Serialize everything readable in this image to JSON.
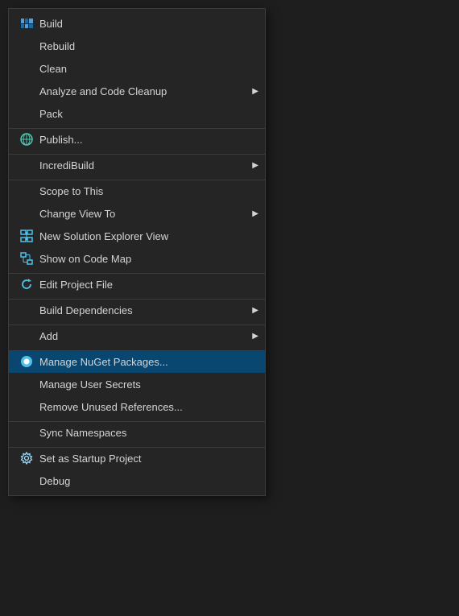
{
  "menu": {
    "items": [
      {
        "id": "build",
        "label": "Build",
        "hasIcon": true,
        "iconType": "build",
        "hasArrow": false,
        "hasDivider": false,
        "highlighted": false
      },
      {
        "id": "rebuild",
        "label": "Rebuild",
        "hasIcon": false,
        "iconType": "",
        "hasArrow": false,
        "hasDivider": false,
        "highlighted": false
      },
      {
        "id": "clean",
        "label": "Clean",
        "hasIcon": false,
        "iconType": "",
        "hasArrow": false,
        "hasDivider": false,
        "highlighted": false
      },
      {
        "id": "analyze-code-cleanup",
        "label": "Analyze and Code Cleanup",
        "hasIcon": false,
        "iconType": "",
        "hasArrow": true,
        "hasDivider": false,
        "highlighted": false
      },
      {
        "id": "pack",
        "label": "Pack",
        "hasIcon": false,
        "iconType": "",
        "hasArrow": false,
        "hasDivider": false,
        "highlighted": false
      },
      {
        "id": "publish",
        "label": "Publish...",
        "hasIcon": true,
        "iconType": "globe",
        "hasArrow": false,
        "hasDivider": true,
        "highlighted": false
      },
      {
        "id": "incredibuild",
        "label": "IncrediBuild",
        "hasIcon": false,
        "iconType": "",
        "hasArrow": true,
        "hasDivider": true,
        "highlighted": false
      },
      {
        "id": "scope-to-this",
        "label": "Scope to This",
        "hasIcon": false,
        "iconType": "",
        "hasArrow": false,
        "hasDivider": true,
        "highlighted": false
      },
      {
        "id": "change-view-to",
        "label": "Change View To",
        "hasIcon": false,
        "iconType": "",
        "hasArrow": true,
        "hasDivider": false,
        "highlighted": false
      },
      {
        "id": "new-solution-explorer",
        "label": "New Solution Explorer View",
        "hasIcon": true,
        "iconType": "solution",
        "hasArrow": false,
        "hasDivider": false,
        "highlighted": false
      },
      {
        "id": "show-code-map",
        "label": "Show on Code Map",
        "hasIcon": true,
        "iconType": "codemap",
        "hasArrow": false,
        "hasDivider": false,
        "highlighted": false
      },
      {
        "id": "edit-project-file",
        "label": "Edit Project File",
        "hasIcon": true,
        "iconType": "refresh",
        "hasArrow": false,
        "hasDivider": true,
        "highlighted": false
      },
      {
        "id": "build-dependencies",
        "label": "Build Dependencies",
        "hasIcon": false,
        "iconType": "",
        "hasArrow": true,
        "hasDivider": true,
        "highlighted": false
      },
      {
        "id": "add",
        "label": "Add",
        "hasIcon": false,
        "iconType": "",
        "hasArrow": true,
        "hasDivider": true,
        "highlighted": false
      },
      {
        "id": "manage-nuget",
        "label": "Manage NuGet Packages...",
        "hasIcon": true,
        "iconType": "nuget",
        "hasArrow": false,
        "hasDivider": true,
        "highlighted": true
      },
      {
        "id": "manage-user-secrets",
        "label": "Manage User Secrets",
        "hasIcon": false,
        "iconType": "",
        "hasArrow": false,
        "hasDivider": false,
        "highlighted": false
      },
      {
        "id": "remove-unused-references",
        "label": "Remove Unused References...",
        "hasIcon": false,
        "iconType": "",
        "hasArrow": false,
        "hasDivider": false,
        "highlighted": false
      },
      {
        "id": "sync-namespaces",
        "label": "Sync Namespaces",
        "hasIcon": false,
        "iconType": "",
        "hasArrow": false,
        "hasDivider": true,
        "highlighted": false
      },
      {
        "id": "set-startup-project",
        "label": "Set as Startup Project",
        "hasIcon": true,
        "iconType": "gear",
        "hasArrow": false,
        "hasDivider": true,
        "highlighted": false
      },
      {
        "id": "debug",
        "label": "Debug",
        "hasIcon": false,
        "iconType": "",
        "hasArrow": false,
        "hasDivider": false,
        "highlighted": false
      }
    ]
  }
}
